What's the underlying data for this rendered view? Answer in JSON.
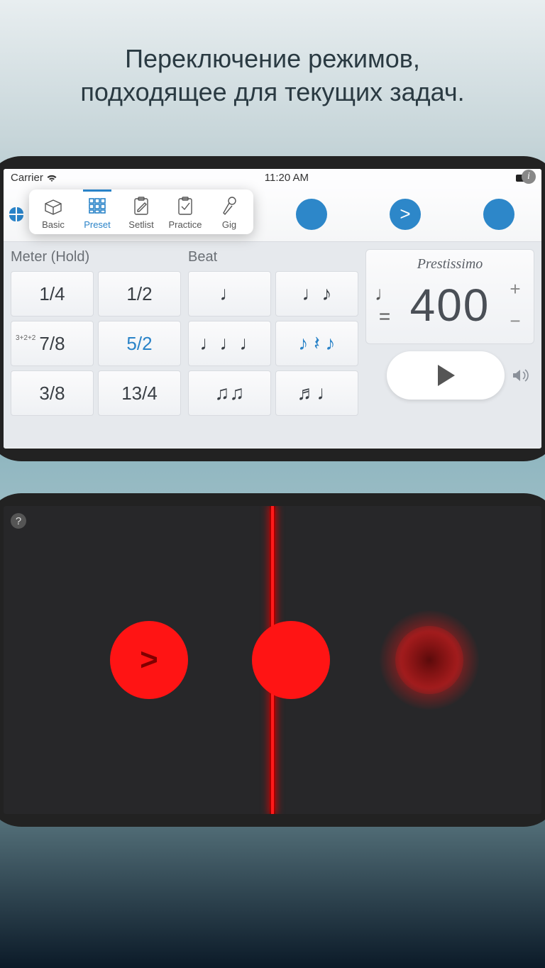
{
  "promo": {
    "line1": "Переключение режимов,",
    "line2": "подходящее для текущих задач."
  },
  "status_bar": {
    "carrier": "Carrier",
    "time": "11:20 AM"
  },
  "modes_popover": {
    "items": [
      {
        "id": "basic",
        "label": "Basic"
      },
      {
        "id": "preset",
        "label": "Preset",
        "active": true
      },
      {
        "id": "setlist",
        "label": "Setlist"
      },
      {
        "id": "practice",
        "label": "Practice"
      },
      {
        "id": "gig",
        "label": "Gig"
      }
    ]
  },
  "labels": {
    "meter": "Meter (Hold)",
    "beat": "Beat"
  },
  "meter_cells": [
    {
      "text": "1/4"
    },
    {
      "text": "1/2"
    },
    {
      "text": "7/8",
      "prefix": "3+2+2"
    },
    {
      "text": "5/2",
      "active": true
    },
    {
      "text": "3/8"
    },
    {
      "text": "13/4"
    }
  ],
  "beat_cells": [
    {
      "glyph": "♩"
    },
    {
      "glyph": "♩♪"
    },
    {
      "glyph": "♩♩♩"
    },
    {
      "glyph": "♪ 𝄽 ♪",
      "active": true
    },
    {
      "glyph": "♫♫"
    },
    {
      "glyph": "♬♩"
    }
  ],
  "tempo": {
    "name": "Prestissimo",
    "note_prefix": "♩ =",
    "value": "400",
    "plus": "+",
    "minus": "−"
  },
  "beat_strip_count": 3,
  "accent_glyph": ">"
}
